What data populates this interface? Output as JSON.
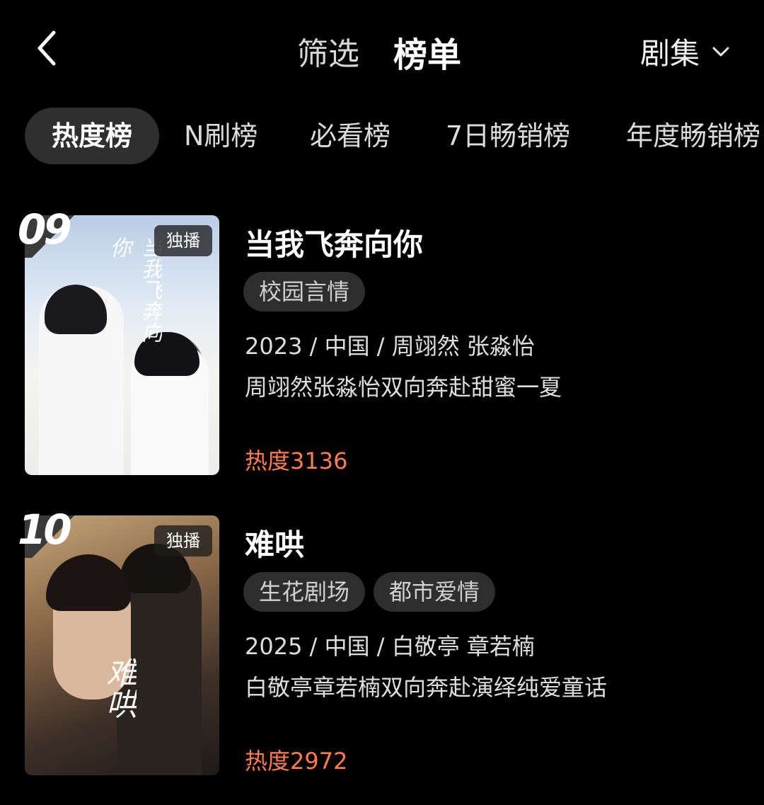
{
  "header": {
    "filter_label": "筛选",
    "rank_label": "榜单",
    "type_label": "剧集"
  },
  "tabs": [
    {
      "label": "热度榜",
      "active": true
    },
    {
      "label": "N刷榜",
      "active": false
    },
    {
      "label": "必看榜",
      "active": false
    },
    {
      "label": "7日畅销榜",
      "active": false
    },
    {
      "label": "年度畅销榜",
      "active": false
    }
  ],
  "items": [
    {
      "rank": "09",
      "badge": "独播",
      "title": "当我飞奔向你",
      "poster_script": "当我飞奔向你",
      "tags": [
        "校园言情"
      ],
      "meta": "2023 / 中国 / 周翊然 张淼怡",
      "desc": "周翊然张淼怡双向奔赴甜蜜一夏",
      "heat": "热度3136"
    },
    {
      "rank": "10",
      "badge": "独播",
      "title": "难哄",
      "poster_script": "难哄",
      "tags": [
        "生花剧场",
        "都市爱情"
      ],
      "meta": "2025 / 中国 / 白敬亭 章若楠",
      "desc": "白敬亭章若楠双向奔赴演绎纯爱童话",
      "heat": "热度2972"
    }
  ],
  "colors": {
    "background": "#000000",
    "heat": "#ff7d4d",
    "tab_active_bg": "#2f2f2f",
    "tag_bg": "#2e2e2e"
  },
  "icons": {
    "back": "chevron-left-icon",
    "dropdown": "chevron-down-icon"
  }
}
